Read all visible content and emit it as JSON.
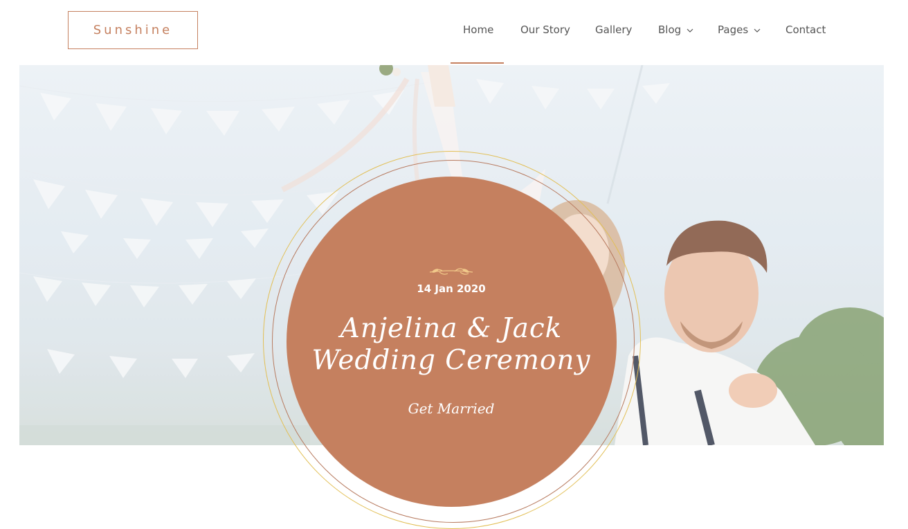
{
  "brand": {
    "logo_text": "Sunshine",
    "accent_color": "#c5805f"
  },
  "nav": {
    "items": [
      {
        "label": "Home",
        "active": true,
        "has_dropdown": false
      },
      {
        "label": "Our Story",
        "active": false,
        "has_dropdown": false
      },
      {
        "label": "Gallery",
        "active": false,
        "has_dropdown": false
      },
      {
        "label": "Blog",
        "active": false,
        "has_dropdown": true
      },
      {
        "label": "Pages",
        "active": false,
        "has_dropdown": true
      },
      {
        "label": "Contact",
        "active": false,
        "has_dropdown": false
      }
    ],
    "dropdown_icon": "chevron-down-icon"
  },
  "hero": {
    "ornament_icon": "leaf-ornament-icon",
    "date": "14 Jan 2020",
    "title_line1": "Anjelina & Jack",
    "title_line2": "Wedding Ceremony",
    "subtitle": "Get Married",
    "circle_color": "#c5805f",
    "ring_outer_color": "#e2bf55",
    "ring_inner_color": "#b77a5f"
  }
}
